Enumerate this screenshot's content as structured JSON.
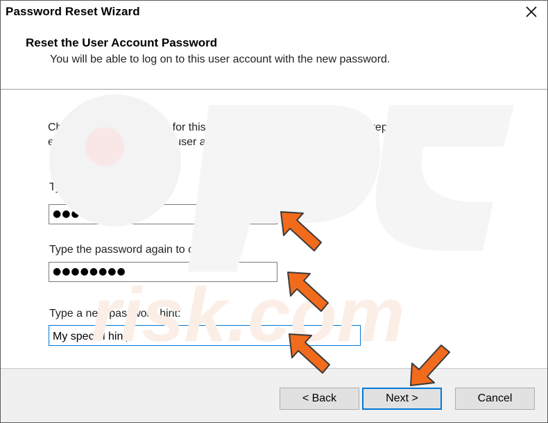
{
  "window": {
    "title": "Password Reset Wizard"
  },
  "header": {
    "title": "Reset the User Account Password",
    "subtitle": "You will be able to log on to this user account with the new password."
  },
  "content": {
    "description": "Choose a new password for this user account. This password will replace the old one; everything else about the user account will remain unchanged.",
    "new_password": {
      "label": "Type a new password:",
      "value": "●●●●●●●●"
    },
    "confirm_password": {
      "label": "Type the password again to confirm:",
      "value": "●●●●●●●●"
    },
    "hint": {
      "label": "Type a new password hint:",
      "value": "My special hint"
    }
  },
  "footer": {
    "back_label": "< Back",
    "next_label": "Next >",
    "cancel_label": "Cancel"
  },
  "colors": {
    "accent": "#0078d7",
    "arrow": "#f26b1d"
  },
  "icons": [
    "close-icon",
    "arrow-pointer-icon"
  ]
}
